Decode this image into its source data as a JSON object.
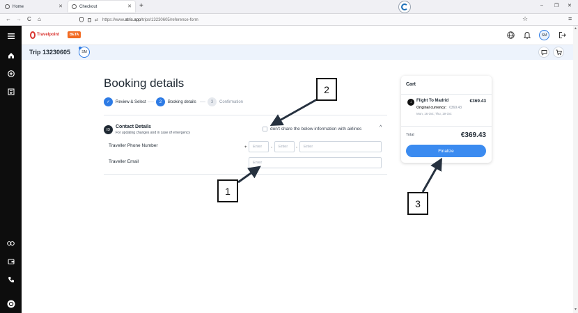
{
  "browser": {
    "tabs": [
      {
        "label": "Home",
        "active": false
      },
      {
        "label": "Checkout",
        "active": true
      }
    ],
    "new_tab": "+",
    "window_controls": {
      "minimize": "–",
      "maximize": "❐",
      "close": "✕"
    },
    "url": {
      "prefix": "https://www.",
      "domain": "atris.app",
      "path": "/trips/13230605/reference-form"
    },
    "nav": {
      "back": "←",
      "forward": "→",
      "reload": "C",
      "home": "⌂"
    },
    "star": "☆",
    "menu": "≡"
  },
  "app": {
    "logo_text": "Travelpoint",
    "beta_label": "BETA",
    "avatar_initials": "SM",
    "accent_color": "#2d7be5",
    "sidebar_icons": [
      "menu-icon",
      "home-icon",
      "add-circle-icon",
      "list-icon",
      "link-icon",
      "wallet-icon",
      "phone-icon",
      "account-icon"
    ],
    "header_icons": [
      "globe-icon",
      "bell-icon",
      "logout-icon"
    ]
  },
  "trip": {
    "title": "Trip 13230605",
    "avatar_initials": "SM"
  },
  "booking": {
    "title": "Booking details",
    "steps": [
      {
        "label": "Review & Select",
        "marker": "✓",
        "state": "done"
      },
      {
        "label": "Booking details",
        "marker": "2",
        "state": "active"
      },
      {
        "label": "Confirmation",
        "marker": "3",
        "state": "pending"
      }
    ],
    "contact": {
      "icon_text": "ID",
      "title": "Contact Details",
      "subtitle": "For updating changes and in case of emergency",
      "share_label": "don't share the below information with airlines",
      "collapse_icon": "^"
    },
    "phone": {
      "label": "Traveller Phone Number",
      "plus": "+",
      "separator": "-",
      "placeholder": "Enter"
    },
    "email": {
      "label": "Traveller Email",
      "placeholder": "Enter"
    }
  },
  "cart": {
    "title": "Cart",
    "item": {
      "name": "Flight To Madrid",
      "price": "€369.43",
      "original_label": "Original currency:",
      "original_value": "€369.43",
      "dates": "Mon, 16 Oct; Thu, 19 Oct"
    },
    "total_label": "Total",
    "total_value": "€369.43",
    "finalize_label": "Finalize"
  },
  "annotations": [
    {
      "number": "1"
    },
    {
      "number": "2"
    },
    {
      "number": "3"
    }
  ]
}
